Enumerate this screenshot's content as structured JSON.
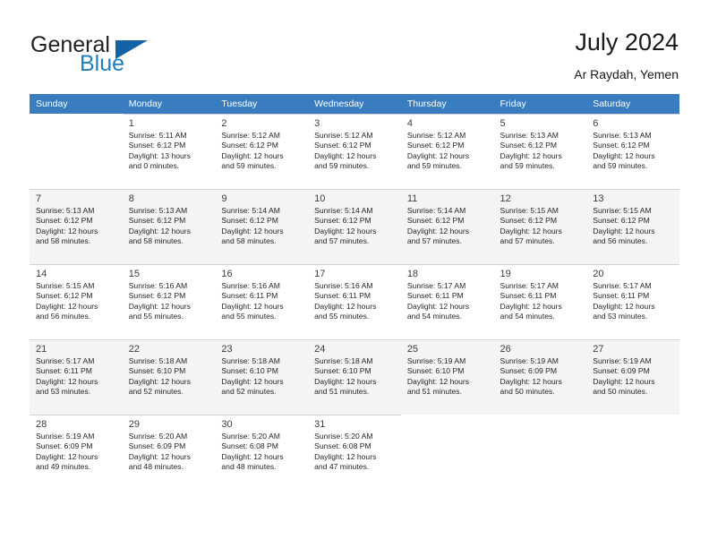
{
  "brand": {
    "name_top": "General",
    "name_bottom": "Blue",
    "accent_color": "#1d7fc3",
    "triangle_color": "#1464a5"
  },
  "header": {
    "title": "July 2024",
    "subtitle": "Ar Raydah, Yemen",
    "header_bg": "#3a7cc0"
  },
  "weekday_headers": [
    "Sunday",
    "Monday",
    "Tuesday",
    "Wednesday",
    "Thursday",
    "Friday",
    "Saturday"
  ],
  "weeks": [
    [
      {
        "day": "",
        "sunrise": "",
        "sunset": "",
        "daylight_line1": "",
        "daylight_line2": ""
      },
      {
        "day": "1",
        "sunrise": "Sunrise: 5:11 AM",
        "sunset": "Sunset: 6:12 PM",
        "daylight_line1": "Daylight: 13 hours",
        "daylight_line2": "and 0 minutes."
      },
      {
        "day": "2",
        "sunrise": "Sunrise: 5:12 AM",
        "sunset": "Sunset: 6:12 PM",
        "daylight_line1": "Daylight: 12 hours",
        "daylight_line2": "and 59 minutes."
      },
      {
        "day": "3",
        "sunrise": "Sunrise: 5:12 AM",
        "sunset": "Sunset: 6:12 PM",
        "daylight_line1": "Daylight: 12 hours",
        "daylight_line2": "and 59 minutes."
      },
      {
        "day": "4",
        "sunrise": "Sunrise: 5:12 AM",
        "sunset": "Sunset: 6:12 PM",
        "daylight_line1": "Daylight: 12 hours",
        "daylight_line2": "and 59 minutes."
      },
      {
        "day": "5",
        "sunrise": "Sunrise: 5:13 AM",
        "sunset": "Sunset: 6:12 PM",
        "daylight_line1": "Daylight: 12 hours",
        "daylight_line2": "and 59 minutes."
      },
      {
        "day": "6",
        "sunrise": "Sunrise: 5:13 AM",
        "sunset": "Sunset: 6:12 PM",
        "daylight_line1": "Daylight: 12 hours",
        "daylight_line2": "and 59 minutes."
      }
    ],
    [
      {
        "day": "7",
        "sunrise": "Sunrise: 5:13 AM",
        "sunset": "Sunset: 6:12 PM",
        "daylight_line1": "Daylight: 12 hours",
        "daylight_line2": "and 58 minutes."
      },
      {
        "day": "8",
        "sunrise": "Sunrise: 5:13 AM",
        "sunset": "Sunset: 6:12 PM",
        "daylight_line1": "Daylight: 12 hours",
        "daylight_line2": "and 58 minutes."
      },
      {
        "day": "9",
        "sunrise": "Sunrise: 5:14 AM",
        "sunset": "Sunset: 6:12 PM",
        "daylight_line1": "Daylight: 12 hours",
        "daylight_line2": "and 58 minutes."
      },
      {
        "day": "10",
        "sunrise": "Sunrise: 5:14 AM",
        "sunset": "Sunset: 6:12 PM",
        "daylight_line1": "Daylight: 12 hours",
        "daylight_line2": "and 57 minutes."
      },
      {
        "day": "11",
        "sunrise": "Sunrise: 5:14 AM",
        "sunset": "Sunset: 6:12 PM",
        "daylight_line1": "Daylight: 12 hours",
        "daylight_line2": "and 57 minutes."
      },
      {
        "day": "12",
        "sunrise": "Sunrise: 5:15 AM",
        "sunset": "Sunset: 6:12 PM",
        "daylight_line1": "Daylight: 12 hours",
        "daylight_line2": "and 57 minutes."
      },
      {
        "day": "13",
        "sunrise": "Sunrise: 5:15 AM",
        "sunset": "Sunset: 6:12 PM",
        "daylight_line1": "Daylight: 12 hours",
        "daylight_line2": "and 56 minutes."
      }
    ],
    [
      {
        "day": "14",
        "sunrise": "Sunrise: 5:15 AM",
        "sunset": "Sunset: 6:12 PM",
        "daylight_line1": "Daylight: 12 hours",
        "daylight_line2": "and 56 minutes."
      },
      {
        "day": "15",
        "sunrise": "Sunrise: 5:16 AM",
        "sunset": "Sunset: 6:12 PM",
        "daylight_line1": "Daylight: 12 hours",
        "daylight_line2": "and 55 minutes."
      },
      {
        "day": "16",
        "sunrise": "Sunrise: 5:16 AM",
        "sunset": "Sunset: 6:11 PM",
        "daylight_line1": "Daylight: 12 hours",
        "daylight_line2": "and 55 minutes."
      },
      {
        "day": "17",
        "sunrise": "Sunrise: 5:16 AM",
        "sunset": "Sunset: 6:11 PM",
        "daylight_line1": "Daylight: 12 hours",
        "daylight_line2": "and 55 minutes."
      },
      {
        "day": "18",
        "sunrise": "Sunrise: 5:17 AM",
        "sunset": "Sunset: 6:11 PM",
        "daylight_line1": "Daylight: 12 hours",
        "daylight_line2": "and 54 minutes."
      },
      {
        "day": "19",
        "sunrise": "Sunrise: 5:17 AM",
        "sunset": "Sunset: 6:11 PM",
        "daylight_line1": "Daylight: 12 hours",
        "daylight_line2": "and 54 minutes."
      },
      {
        "day": "20",
        "sunrise": "Sunrise: 5:17 AM",
        "sunset": "Sunset: 6:11 PM",
        "daylight_line1": "Daylight: 12 hours",
        "daylight_line2": "and 53 minutes."
      }
    ],
    [
      {
        "day": "21",
        "sunrise": "Sunrise: 5:17 AM",
        "sunset": "Sunset: 6:11 PM",
        "daylight_line1": "Daylight: 12 hours",
        "daylight_line2": "and 53 minutes."
      },
      {
        "day": "22",
        "sunrise": "Sunrise: 5:18 AM",
        "sunset": "Sunset: 6:10 PM",
        "daylight_line1": "Daylight: 12 hours",
        "daylight_line2": "and 52 minutes."
      },
      {
        "day": "23",
        "sunrise": "Sunrise: 5:18 AM",
        "sunset": "Sunset: 6:10 PM",
        "daylight_line1": "Daylight: 12 hours",
        "daylight_line2": "and 52 minutes."
      },
      {
        "day": "24",
        "sunrise": "Sunrise: 5:18 AM",
        "sunset": "Sunset: 6:10 PM",
        "daylight_line1": "Daylight: 12 hours",
        "daylight_line2": "and 51 minutes."
      },
      {
        "day": "25",
        "sunrise": "Sunrise: 5:19 AM",
        "sunset": "Sunset: 6:10 PM",
        "daylight_line1": "Daylight: 12 hours",
        "daylight_line2": "and 51 minutes."
      },
      {
        "day": "26",
        "sunrise": "Sunrise: 5:19 AM",
        "sunset": "Sunset: 6:09 PM",
        "daylight_line1": "Daylight: 12 hours",
        "daylight_line2": "and 50 minutes."
      },
      {
        "day": "27",
        "sunrise": "Sunrise: 5:19 AM",
        "sunset": "Sunset: 6:09 PM",
        "daylight_line1": "Daylight: 12 hours",
        "daylight_line2": "and 50 minutes."
      }
    ],
    [
      {
        "day": "28",
        "sunrise": "Sunrise: 5:19 AM",
        "sunset": "Sunset: 6:09 PM",
        "daylight_line1": "Daylight: 12 hours",
        "daylight_line2": "and 49 minutes."
      },
      {
        "day": "29",
        "sunrise": "Sunrise: 5:20 AM",
        "sunset": "Sunset: 6:09 PM",
        "daylight_line1": "Daylight: 12 hours",
        "daylight_line2": "and 48 minutes."
      },
      {
        "day": "30",
        "sunrise": "Sunrise: 5:20 AM",
        "sunset": "Sunset: 6:08 PM",
        "daylight_line1": "Daylight: 12 hours",
        "daylight_line2": "and 48 minutes."
      },
      {
        "day": "31",
        "sunrise": "Sunrise: 5:20 AM",
        "sunset": "Sunset: 6:08 PM",
        "daylight_line1": "Daylight: 12 hours",
        "daylight_line2": "and 47 minutes."
      },
      {
        "day": "",
        "sunrise": "",
        "sunset": "",
        "daylight_line1": "",
        "daylight_line2": ""
      },
      {
        "day": "",
        "sunrise": "",
        "sunset": "",
        "daylight_line1": "",
        "daylight_line2": ""
      },
      {
        "day": "",
        "sunrise": "",
        "sunset": "",
        "daylight_line1": "",
        "daylight_line2": ""
      }
    ]
  ]
}
